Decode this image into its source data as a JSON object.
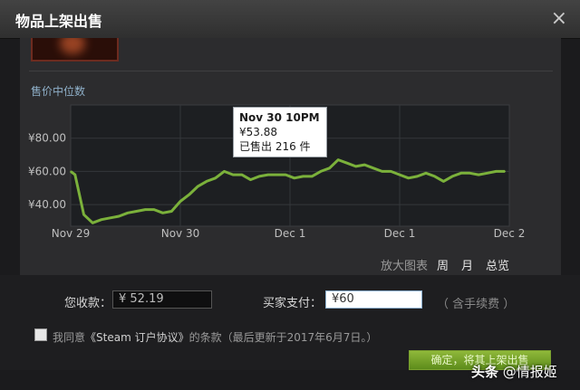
{
  "dialog": {
    "title": "物品上架出售",
    "close_glyph": "×"
  },
  "chart_section": {
    "label": "售价中位数",
    "tooltip": {
      "time": "Nov 30 10PM",
      "price": "¥53.88",
      "sold": "已售出 216 件"
    },
    "zoom": {
      "label": "放大图表",
      "week": "周",
      "month": "月",
      "total": "总览"
    }
  },
  "chart_data": {
    "type": "line",
    "x_ticks": [
      "Nov 29",
      "Nov 30",
      "Dec 1",
      "Dec 1",
      "Dec 2"
    ],
    "y_ticks": [
      "¥80.00",
      "¥60.00",
      "¥40.00"
    ],
    "ylim": [
      27,
      100
    ],
    "line_color": "#7bb13b",
    "series": [
      {
        "x": [
          0,
          1,
          3,
          5,
          7,
          9,
          11,
          13,
          15,
          17,
          19,
          21,
          23,
          25,
          27,
          29,
          31,
          33,
          35,
          37,
          39,
          41,
          43,
          45,
          47,
          49,
          51,
          53,
          55,
          57,
          59,
          61,
          63,
          65,
          67,
          69,
          71,
          73,
          75,
          77,
          79,
          81,
          83,
          85,
          87,
          89,
          91,
          93,
          95,
          97,
          99
        ],
        "values": [
          60,
          58,
          34,
          29,
          31,
          32,
          33,
          35,
          36,
          37,
          37,
          35,
          36,
          42,
          46,
          51,
          54,
          56,
          60,
          58,
          58,
          55,
          57,
          58,
          58,
          58,
          56,
          57,
          57,
          60,
          62,
          67,
          65,
          63,
          64,
          62,
          60,
          60,
          58,
          56,
          57,
          59,
          57,
          54,
          57,
          59,
          59,
          58,
          59,
          60,
          60
        ]
      }
    ]
  },
  "form": {
    "you_receive_label": "您收款：",
    "you_receive_value": "¥ 52.19",
    "buyer_pays_label": "买家支付：",
    "buyer_pays_value": "¥60",
    "fee_note": "（ 含手续费 ）",
    "agree_prefix": "我同意",
    "agree_link": "《Steam 订户协议》",
    "agree_suffix": "的条款（最后更新于2017年6月7日。）",
    "confirm_button": "确定，将其上架出售"
  },
  "watermark": {
    "brand": "头条",
    "account": "@情报姬"
  }
}
